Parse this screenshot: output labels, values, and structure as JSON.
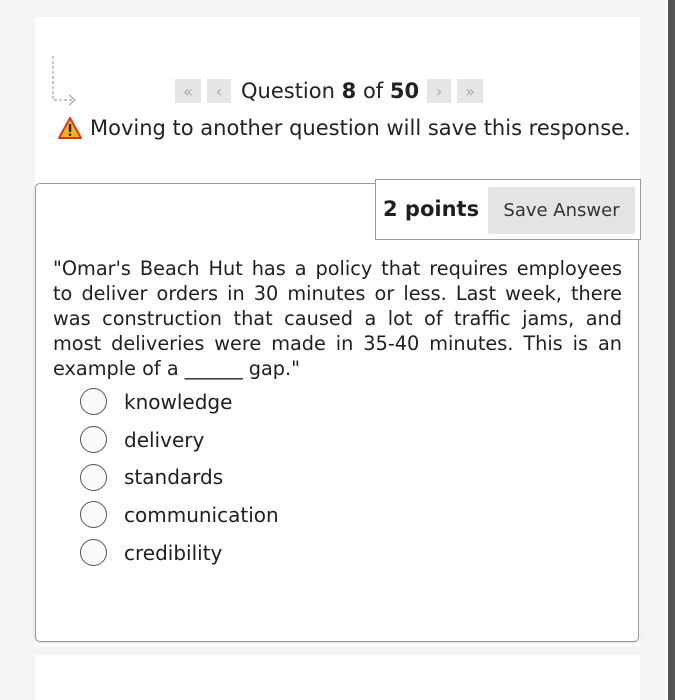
{
  "navigation": {
    "first_icon": "double-chevron-left-icon",
    "prev_icon": "chevron-left-icon",
    "next_icon": "chevron-right-icon",
    "last_icon": "double-chevron-right-icon",
    "question_word": "Question",
    "current": "8",
    "of_word": "of",
    "total": "50"
  },
  "warning": {
    "icon": "warning-icon",
    "text": "Moving to another question will save this response."
  },
  "question": {
    "points": "2 points",
    "save_label": "Save Answer",
    "text": "\"Omar's Beach Hut has a policy that requires employees to deliver orders in 30 minutes or less. Last week, there was construction that caused a lot of traffic jams, and most deliveries were made in 35-40 minutes. This is an example of a ______ gap.\"",
    "options": [
      "knowledge",
      "delivery",
      "standards",
      "communication",
      "credibility"
    ]
  }
}
